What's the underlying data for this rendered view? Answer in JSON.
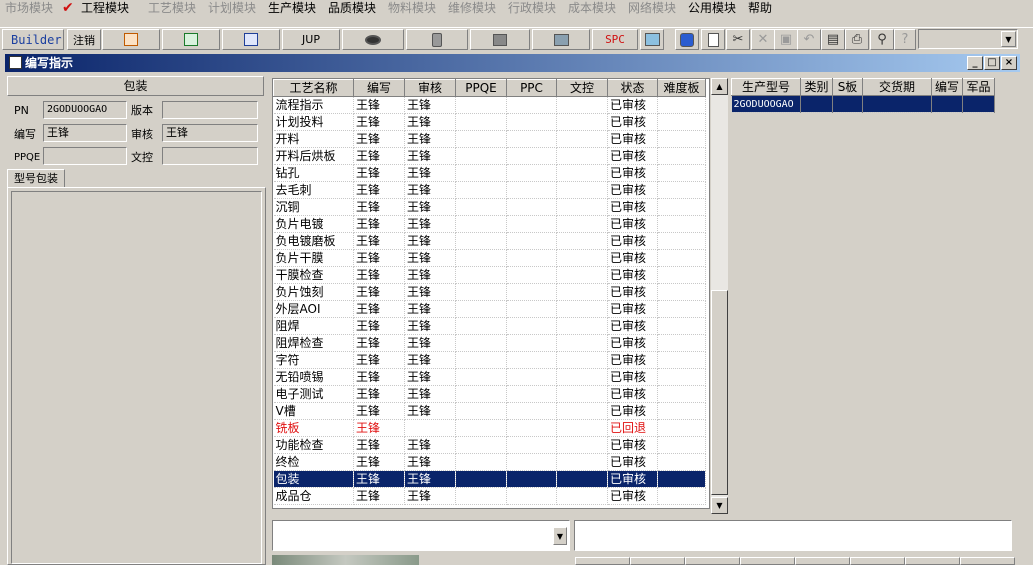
{
  "menu": {
    "items": [
      {
        "label": "市场模块",
        "enabled": false
      },
      {
        "label": "工程模块",
        "enabled": true
      },
      {
        "label": "工艺模块",
        "enabled": false
      },
      {
        "label": "计划模块",
        "enabled": false
      },
      {
        "label": "生产模块",
        "enabled": true
      },
      {
        "label": "品质模块",
        "enabled": true
      },
      {
        "label": "物料模块",
        "enabled": false
      },
      {
        "label": "维修模块",
        "enabled": false
      },
      {
        "label": "行政模块",
        "enabled": false
      },
      {
        "label": "成本模块",
        "enabled": false
      },
      {
        "label": "网络模块",
        "enabled": false
      },
      {
        "label": "公用模块",
        "enabled": true
      },
      {
        "label": "帮助",
        "enabled": true
      }
    ]
  },
  "toolbar": {
    "builder_label": "Builder",
    "logout_label": "注销",
    "jup_label": "JUP",
    "spc_label": "SPC",
    "icons": [
      "orange-report-icon",
      "excel-icon",
      "word-icon",
      "eye-icon",
      "database-icon",
      "network-icon",
      "monitor-icon",
      "picture-icon",
      "pen-icon",
      "new-doc-icon",
      "cut-icon",
      "delete-icon",
      "save-icon",
      "undo-icon",
      "preview-icon",
      "print-icon",
      "find-icon",
      "help-icon"
    ]
  },
  "window": {
    "title": "编写指示"
  },
  "left": {
    "header": "包装",
    "pn_label": "PN",
    "pn_value": "2GODUOOGAO",
    "version_label": "版本",
    "version_value": "",
    "writer_label": "编写",
    "writer_value": "王锋",
    "reviewer_label": "审核",
    "reviewer_value": "王锋",
    "ppqe_label": "PPQE",
    "ppqe_value": "",
    "doc_label": "文控",
    "doc_value": "",
    "tab_label": "型号包装"
  },
  "grid": {
    "columns": [
      "工艺名称",
      "编写",
      "审核",
      "PPQE",
      "PPC",
      "文控",
      "状态",
      "难度板"
    ],
    "rows": [
      {
        "name": "流程指示",
        "writer": "王锋",
        "reviewer": "王锋",
        "ppqe": "",
        "ppc": "",
        "doc": "",
        "status": "已审核",
        "diff": "",
        "style": ""
      },
      {
        "name": "计划投料",
        "writer": "王锋",
        "reviewer": "王锋",
        "ppqe": "",
        "ppc": "",
        "doc": "",
        "status": "已审核",
        "diff": "",
        "style": ""
      },
      {
        "name": "开料",
        "writer": "王锋",
        "reviewer": "王锋",
        "ppqe": "",
        "ppc": "",
        "doc": "",
        "status": "已审核",
        "diff": "",
        "style": ""
      },
      {
        "name": "开料后烘板",
        "writer": "王锋",
        "reviewer": "王锋",
        "ppqe": "",
        "ppc": "",
        "doc": "",
        "status": "已审核",
        "diff": "",
        "style": ""
      },
      {
        "name": "钻孔",
        "writer": "王锋",
        "reviewer": "王锋",
        "ppqe": "",
        "ppc": "",
        "doc": "",
        "status": "已审核",
        "diff": "",
        "style": ""
      },
      {
        "name": "去毛刺",
        "writer": "王锋",
        "reviewer": "王锋",
        "ppqe": "",
        "ppc": "",
        "doc": "",
        "status": "已审核",
        "diff": "",
        "style": ""
      },
      {
        "name": "沉铜",
        "writer": "王锋",
        "reviewer": "王锋",
        "ppqe": "",
        "ppc": "",
        "doc": "",
        "status": "已审核",
        "diff": "",
        "style": ""
      },
      {
        "name": "负片电镀",
        "writer": "王锋",
        "reviewer": "王锋",
        "ppqe": "",
        "ppc": "",
        "doc": "",
        "status": "已审核",
        "diff": "",
        "style": ""
      },
      {
        "name": "负电镀磨板",
        "writer": "王锋",
        "reviewer": "王锋",
        "ppqe": "",
        "ppc": "",
        "doc": "",
        "status": "已审核",
        "diff": "",
        "style": ""
      },
      {
        "name": "负片干膜",
        "writer": "王锋",
        "reviewer": "王锋",
        "ppqe": "",
        "ppc": "",
        "doc": "",
        "status": "已审核",
        "diff": "",
        "style": ""
      },
      {
        "name": "干膜检查",
        "writer": "王锋",
        "reviewer": "王锋",
        "ppqe": "",
        "ppc": "",
        "doc": "",
        "status": "已审核",
        "diff": "",
        "style": ""
      },
      {
        "name": "负片蚀刻",
        "writer": "王锋",
        "reviewer": "王锋",
        "ppqe": "",
        "ppc": "",
        "doc": "",
        "status": "已审核",
        "diff": "",
        "style": ""
      },
      {
        "name": "外层AOI",
        "writer": "王锋",
        "reviewer": "王锋",
        "ppqe": "",
        "ppc": "",
        "doc": "",
        "status": "已审核",
        "diff": "",
        "style": ""
      },
      {
        "name": "阻焊",
        "writer": "王锋",
        "reviewer": "王锋",
        "ppqe": "",
        "ppc": "",
        "doc": "",
        "status": "已审核",
        "diff": "",
        "style": ""
      },
      {
        "name": "阻焊检查",
        "writer": "王锋",
        "reviewer": "王锋",
        "ppqe": "",
        "ppc": "",
        "doc": "",
        "status": "已审核",
        "diff": "",
        "style": ""
      },
      {
        "name": "字符",
        "writer": "王锋",
        "reviewer": "王锋",
        "ppqe": "",
        "ppc": "",
        "doc": "",
        "status": "已审核",
        "diff": "",
        "style": ""
      },
      {
        "name": "无铅喷锡",
        "writer": "王锋",
        "reviewer": "王锋",
        "ppqe": "",
        "ppc": "",
        "doc": "",
        "status": "已审核",
        "diff": "",
        "style": ""
      },
      {
        "name": "电子测试",
        "writer": "王锋",
        "reviewer": "王锋",
        "ppqe": "",
        "ppc": "",
        "doc": "",
        "status": "已审核",
        "diff": "",
        "style": ""
      },
      {
        "name": "V槽",
        "writer": "王锋",
        "reviewer": "王锋",
        "ppqe": "",
        "ppc": "",
        "doc": "",
        "status": "已审核",
        "diff": "",
        "style": ""
      },
      {
        "name": "铣板",
        "writer": "王锋",
        "reviewer": "",
        "ppqe": "",
        "ppc": "",
        "doc": "",
        "status": "已回退",
        "diff": "",
        "style": "red"
      },
      {
        "name": "功能检查",
        "writer": "王锋",
        "reviewer": "王锋",
        "ppqe": "",
        "ppc": "",
        "doc": "",
        "status": "已审核",
        "diff": "",
        "style": ""
      },
      {
        "name": "终检",
        "writer": "王锋",
        "reviewer": "王锋",
        "ppqe": "",
        "ppc": "",
        "doc": "",
        "status": "已审核",
        "diff": "",
        "style": ""
      },
      {
        "name": "包装",
        "writer": "王锋",
        "reviewer": "王锋",
        "ppqe": "",
        "ppc": "",
        "doc": "",
        "status": "已审核",
        "diff": "",
        "style": "sel"
      },
      {
        "name": "成品仓",
        "writer": "王锋",
        "reviewer": "王锋",
        "ppqe": "",
        "ppc": "",
        "doc": "",
        "status": "已审核",
        "diff": "",
        "style": ""
      }
    ]
  },
  "rgrid": {
    "columns": [
      "生产型号",
      "类别",
      "S板",
      "交货期",
      "编写",
      "军品"
    ],
    "rows": [
      {
        "model": "2GODUOOGAO",
        "type": "",
        "s": "",
        "date": "",
        "writer": "",
        "mil": ""
      }
    ]
  },
  "colors": {
    "selection": "#0a246a",
    "rollback": "#e01010",
    "titlebar_start": "#0a246a",
    "titlebar_end": "#a6caf0"
  }
}
